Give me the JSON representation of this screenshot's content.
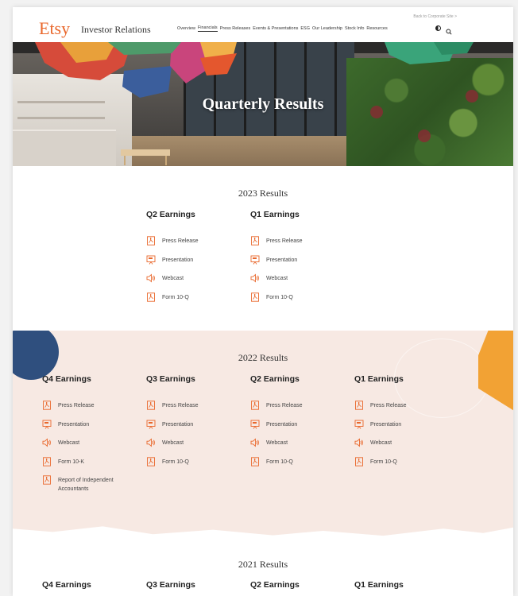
{
  "header": {
    "logo": "Etsy",
    "site_title": "Investor Relations",
    "corporate_link": "Back to Corporate Site >",
    "nav": [
      {
        "label": "Overview"
      },
      {
        "label": "Financials",
        "active": true
      },
      {
        "label": "Press Releases"
      },
      {
        "label": "Events & Presentations"
      },
      {
        "label": "ESG"
      },
      {
        "label": "Our Leadership"
      },
      {
        "label": "Stock Info"
      },
      {
        "label": "Resources"
      }
    ],
    "icons": {
      "theme": "contrast-toggle-icon",
      "search": "search-icon"
    }
  },
  "hero": {
    "title": "Quarterly Results"
  },
  "colors": {
    "brand": "#e9672b",
    "band": "#f7e9e3",
    "accent_blue": "#2f4f7e",
    "accent_orange": "#f2a234"
  },
  "years": [
    {
      "title": "2023 Results",
      "quarters": [
        {
          "title": "Q2 Earnings",
          "links": [
            {
              "label": "Press Release",
              "icon": "pdf-icon"
            },
            {
              "label": "Presentation",
              "icon": "presentation-icon"
            },
            {
              "label": "Webcast",
              "icon": "speaker-icon"
            },
            {
              "label": "Form 10-Q",
              "icon": "pdf-icon"
            }
          ]
        },
        {
          "title": "Q1 Earnings",
          "links": [
            {
              "label": "Press Release",
              "icon": "pdf-icon"
            },
            {
              "label": "Presentation",
              "icon": "presentation-icon"
            },
            {
              "label": "Webcast",
              "icon": "speaker-icon"
            },
            {
              "label": "Form 10-Q",
              "icon": "pdf-icon"
            }
          ]
        }
      ]
    },
    {
      "title": "2022 Results",
      "quarters": [
        {
          "title": "Q4 Earnings",
          "links": [
            {
              "label": "Press Release",
              "icon": "pdf-icon"
            },
            {
              "label": "Presentation",
              "icon": "presentation-icon"
            },
            {
              "label": "Webcast",
              "icon": "speaker-icon"
            },
            {
              "label": "Form 10-K",
              "icon": "pdf-icon"
            },
            {
              "label": "Report of Independent Accountants",
              "icon": "pdf-icon"
            }
          ]
        },
        {
          "title": "Q3 Earnings",
          "links": [
            {
              "label": "Press Release",
              "icon": "pdf-icon"
            },
            {
              "label": "Presentation",
              "icon": "presentation-icon"
            },
            {
              "label": "Webcast",
              "icon": "speaker-icon"
            },
            {
              "label": "Form 10-Q",
              "icon": "pdf-icon"
            }
          ]
        },
        {
          "title": "Q2 Earnings",
          "links": [
            {
              "label": "Press Release",
              "icon": "pdf-icon"
            },
            {
              "label": "Presentation",
              "icon": "presentation-icon"
            },
            {
              "label": "Webcast",
              "icon": "speaker-icon"
            },
            {
              "label": "Form 10-Q",
              "icon": "pdf-icon"
            }
          ]
        },
        {
          "title": "Q1 Earnings",
          "links": [
            {
              "label": "Press Release",
              "icon": "pdf-icon"
            },
            {
              "label": "Presentation",
              "icon": "presentation-icon"
            },
            {
              "label": "Webcast",
              "icon": "speaker-icon"
            },
            {
              "label": "Form 10-Q",
              "icon": "pdf-icon"
            }
          ]
        }
      ]
    },
    {
      "title": "2021 Results",
      "quarters": [
        {
          "title": "Q4 Earnings",
          "links": []
        },
        {
          "title": "Q3 Earnings",
          "links": []
        },
        {
          "title": "Q2 Earnings",
          "links": []
        },
        {
          "title": "Q1 Earnings",
          "links": []
        }
      ]
    }
  ]
}
